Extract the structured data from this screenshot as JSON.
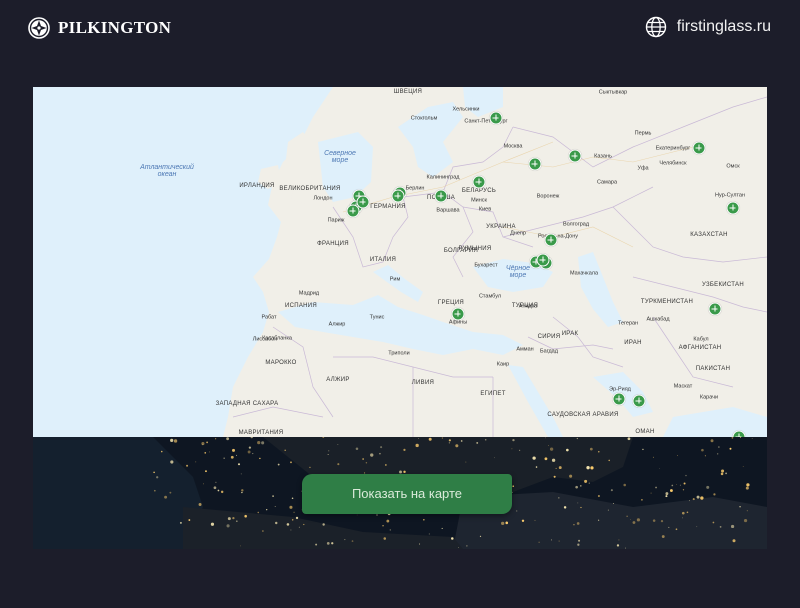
{
  "header": {
    "brand": "PILKINGTON",
    "site": "firstinglass.ru"
  },
  "map": {
    "seas": [
      {
        "id": "atlantic",
        "text": "Атлантический\nокеан"
      },
      {
        "id": "north-sea",
        "text": "Северное\nморе"
      },
      {
        "id": "black-sea",
        "text": "Чёрное\nморе"
      }
    ],
    "countries": [
      "ШВЕЦИЯ",
      "ВЕЛИКОБРИТАНИЯ",
      "ГЕРМАНИЯ",
      "ПОЛЬША",
      "БЕЛАРУСЬ",
      "УКРАИНА",
      "ФРАНЦИЯ",
      "ИТАЛИЯ",
      "ИСПАНИЯ",
      "ТУРЦИЯ",
      "КАЗАХСТАН",
      "УЗБЕКИСТАН",
      "ТУРКМЕНИСТАН",
      "ИРАН",
      "ИРАК",
      "СИРИЯ",
      "АФГАНИСТАН",
      "ПАКИСТАН",
      "АЛЖИР",
      "ЛИВИЯ",
      "ЕГИПЕТ",
      "МАРОККО",
      "САУДОВСКАЯ АРАВИЯ",
      "МАВРИТАНИЯ",
      "ЗАПАДНАЯ САХАРА",
      "ОМАН",
      "РУМЫНИЯ",
      "ГРЕЦИЯ",
      "БОЛГАРИЯ",
      "ИРЛАНДИЯ"
    ],
    "cities": [
      "Хельсинки",
      "Санкт-Петербург",
      "Стокгольм",
      "Москва",
      "Сыктывкар",
      "Пермь",
      "Екатеринбург",
      "Казань",
      "Уфа",
      "Челябинск",
      "Омск",
      "Самара",
      "Нур-Султан",
      "Лондон",
      "Париж",
      "Берлин",
      "Калининград",
      "Варшава",
      "Минск",
      "Киев",
      "Воронеж",
      "Волгоград",
      "Днепр",
      "Ростов-на-Дону",
      "Бухарест",
      "Стамбул",
      "Анкара",
      "Рим",
      "Тунис",
      "Мадрид",
      "Лиссабон",
      "Алжир",
      "Рабат",
      "Касабланка",
      "Триполи",
      "Каир",
      "Амман",
      "Багдад",
      "Тегеран",
      "Ашхабад",
      "Кабул",
      "Карачи",
      "Эр-Рияд",
      "Маскат",
      "Махачкала",
      "Афины"
    ],
    "pins_count": 26
  },
  "cta": {
    "show_map": "Показать на карте"
  }
}
